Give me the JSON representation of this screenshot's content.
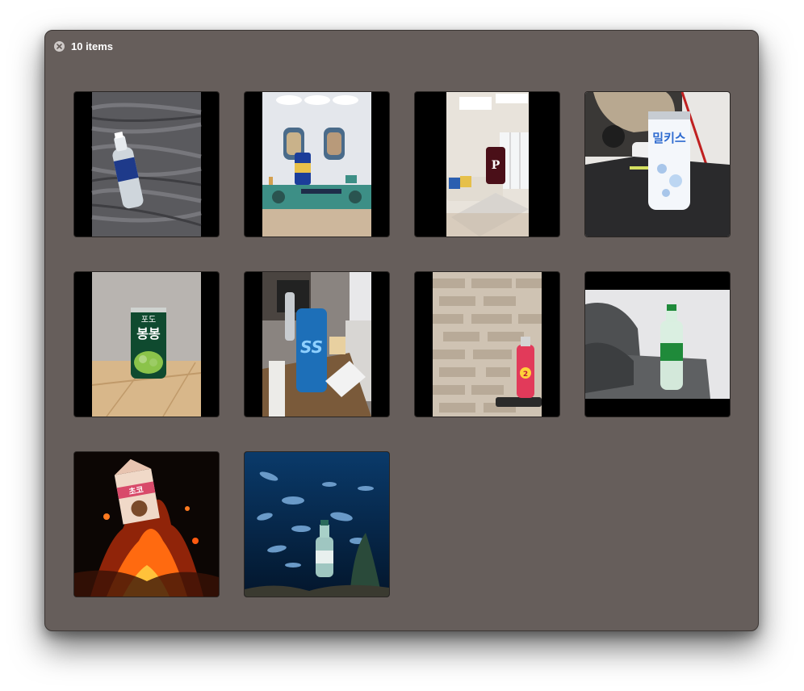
{
  "window": {
    "title": "10 items",
    "close_icon": "close-circle-icon"
  },
  "items": [
    {
      "id": 1,
      "subject": "water bottle on gray bedsheet"
    },
    {
      "id": 2,
      "subject": "beer can on tv cabinet"
    },
    {
      "id": 3,
      "subject": "soda can in living room",
      "can_text": "P"
    },
    {
      "id": 4,
      "subject": "milkis can on desk",
      "can_text": "밀키스"
    },
    {
      "id": 5,
      "subject": "grape bongbong can",
      "can_text_top": "포도",
      "can_text": "봉봉"
    },
    {
      "id": 6,
      "subject": "blue can on desk",
      "can_text": "SS"
    },
    {
      "id": 7,
      "subject": "red bottle against brick wall",
      "label_text": "2"
    },
    {
      "id": 8,
      "subject": "green soda bottle by sofa"
    },
    {
      "id": 9,
      "subject": "milk carton over volcano",
      "label_text": "초코"
    },
    {
      "id": 10,
      "subject": "bottle in aquarium with fish"
    }
  ],
  "colors": {
    "window_bg": "#665e5b",
    "thumb_bg": "#000000",
    "title_text": "#ffffff"
  }
}
